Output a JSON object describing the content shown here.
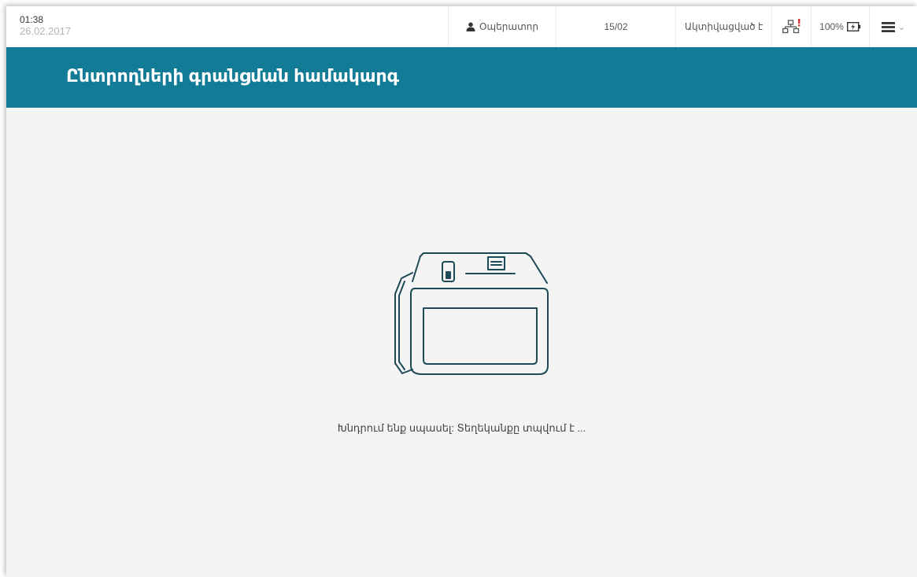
{
  "status_bar": {
    "time": "01:38",
    "date": "26.02.2017",
    "operator_label": "Օպերատոր",
    "counter": "15/02",
    "status_label": "Ակտիվացված է",
    "battery_label": "100%",
    "icons": {
      "user": "user-icon",
      "network": "network-alert-icon",
      "battery": "battery-charging-icon",
      "menu": "hamburger-menu-icon",
      "chevron": "chevron-down-icon"
    }
  },
  "header": {
    "title": "Ընտրողների գրանցման համակարգ"
  },
  "main": {
    "illustration": "registration-device-icon",
    "message": "Խնդրում ենք սպասել: Տեղեկանքը տպվում է ..."
  },
  "colors": {
    "header_bg": "#127b96",
    "page_bg": "#f4f4f4",
    "alert": "#d32f2f",
    "device_stroke": "#1c4a56"
  }
}
